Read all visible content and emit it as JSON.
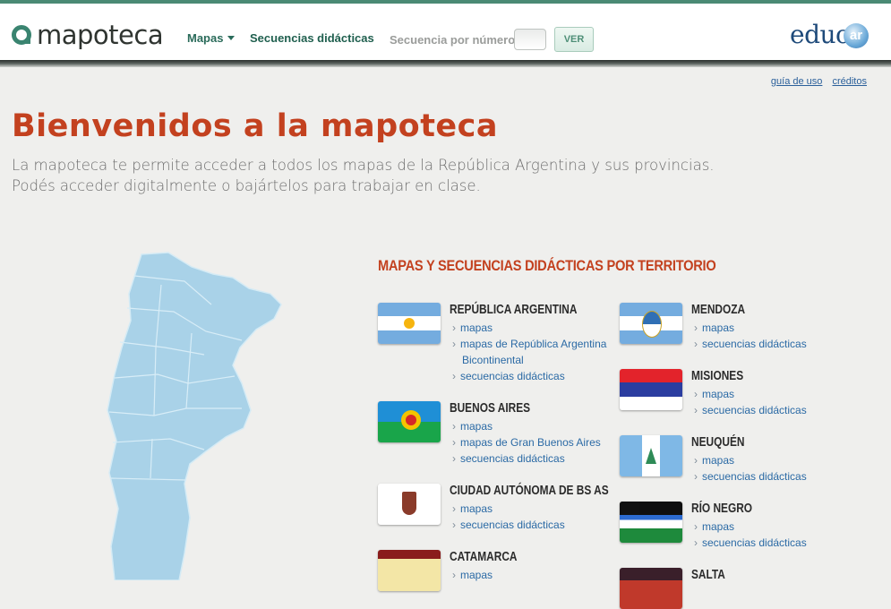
{
  "header": {
    "logo_text": "mapoteca",
    "nav": {
      "mapas_label": "Mapas",
      "secuencias_label": "Secuencias didácticas"
    },
    "sequence_search": {
      "label": "Secuencia por número:",
      "value": "",
      "button_label": "VER"
    },
    "brand_logo": {
      "prefix": "educ",
      "suffix": "ar"
    }
  },
  "util_links": {
    "guide": "guía de uso",
    "credits": "créditos"
  },
  "main": {
    "title": "Bienvenidos a la mapoteca",
    "intro_line1": "La mapoteca te permite acceder a todos los mapas de la República Argentina y sus provincias.",
    "intro_line2": "Podés acceder digitalmente o bajártelos para trabajar en clase.",
    "section_heading": "MAPAS Y SECUENCIAS DIDÁCTICAS POR TERRITORIO"
  },
  "territories": {
    "argentina": {
      "name": "REPÚBLICA ARGENTINA",
      "links": [
        "mapas",
        "mapas de República Argentina",
        "Bicontinental",
        "secuencias didácticas"
      ]
    },
    "buenos_aires": {
      "name": "BUENOS AIRES",
      "links": [
        "mapas",
        "mapas de Gran Buenos Aires",
        "secuencias didácticas"
      ]
    },
    "caba": {
      "name": "CIUDAD AUTÓNOMA DE BS AS",
      "links": [
        "mapas",
        "secuencias didácticas"
      ]
    },
    "catamarca": {
      "name": "CATAMARCA",
      "links": [
        "mapas"
      ]
    },
    "mendoza": {
      "name": "MENDOZA",
      "links": [
        "mapas",
        "secuencias didácticas"
      ]
    },
    "misiones": {
      "name": "MISIONES",
      "links": [
        "mapas",
        "secuencias didácticas"
      ]
    },
    "neuquen": {
      "name": "NEUQUÉN",
      "links": [
        "mapas",
        "secuencias didácticas"
      ]
    },
    "rio_negro": {
      "name": "RÍO NEGRO",
      "links": [
        "mapas",
        "secuencias didácticas"
      ]
    },
    "salta": {
      "name": "SALTA"
    }
  },
  "colors": {
    "accent_red": "#c3411f",
    "brand_green": "#2a6b5a",
    "link_blue": "#2b6aa5",
    "map_blue": "#a9d2e8"
  },
  "icons": {
    "logo": "map-pin-icon",
    "dropdown": "chevron-down-icon",
    "bullet": "chevron-right-icon"
  }
}
